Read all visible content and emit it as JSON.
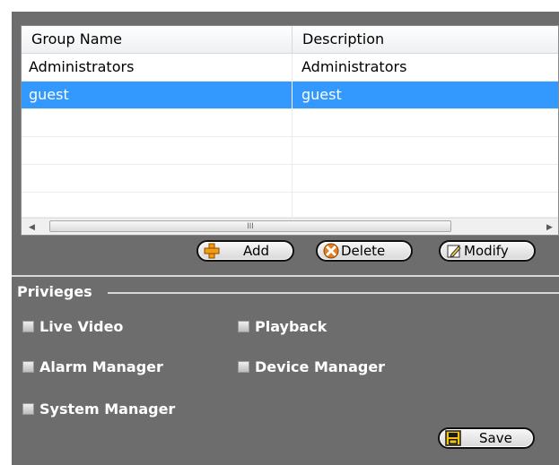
{
  "table": {
    "columns": [
      "Group Name",
      "Description"
    ],
    "rows": [
      {
        "name": "Administrators",
        "description": "Administrators",
        "selected": false
      },
      {
        "name": "guest",
        "description": "guest",
        "selected": true
      }
    ],
    "scrollbar_grip": "III"
  },
  "buttons": {
    "add": {
      "label": "Add",
      "icon": "plus-icon"
    },
    "delete": {
      "label": "Delete",
      "icon": "x-icon"
    },
    "modify": {
      "label": "Modify",
      "icon": "pencil-icon"
    },
    "save": {
      "label": "Save",
      "icon": "save-icon"
    }
  },
  "privileges": {
    "title": "Privieges",
    "items": [
      {
        "label": "Live Video",
        "checked": false
      },
      {
        "label": "Playback",
        "checked": false
      },
      {
        "label": "Alarm Manager",
        "checked": false
      },
      {
        "label": "Device Manager",
        "checked": false
      },
      {
        "label": "System Manager",
        "checked": false
      }
    ]
  },
  "colors": {
    "panel": "#6d6d6d",
    "selection": "#3399ff",
    "add_icon": "#f39c12",
    "delete_icon": "#e67e22"
  }
}
